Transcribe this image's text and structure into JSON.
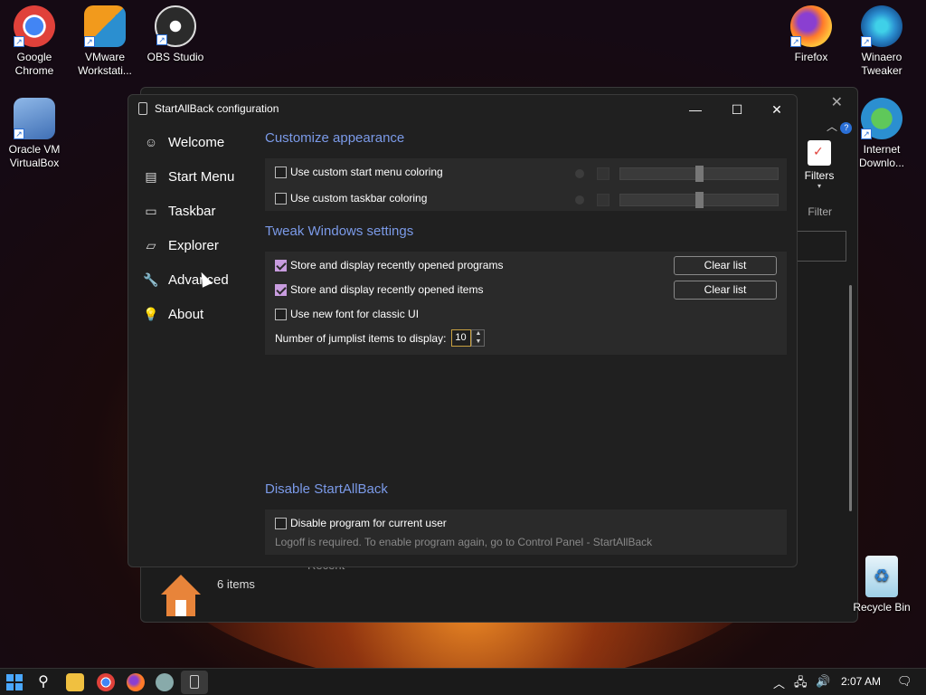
{
  "desktop": {
    "icons": [
      {
        "name": "desk-icon-chrome",
        "label": "Google Chrome",
        "color": "#e0413a"
      },
      {
        "name": "desk-icon-vmware",
        "label": "VMware Workstati...",
        "color": "#f29a1c"
      },
      {
        "name": "desk-icon-obs",
        "label": "OBS Studio",
        "color": "#2b2b2b"
      },
      {
        "name": "desk-icon-virtualbox",
        "label": "Oracle VM VirtualBox",
        "color": "#3f6fb5"
      },
      {
        "name": "desk-icon-firefox",
        "label": "Firefox",
        "color": "#ff7a2a"
      },
      {
        "name": "desk-icon-winaero",
        "label": "Winaero Tweaker",
        "color": "#2b8fd0"
      },
      {
        "name": "desk-icon-internet-download",
        "label": "Internet Downlo...",
        "color": "#3fa84a"
      },
      {
        "name": "desk-icon-recycle-bin",
        "label": "Recycle Bin",
        "color": "#9fd0e8"
      }
    ]
  },
  "explorer": {
    "filters_label": "Filters",
    "filter_group_label": "Filter",
    "items_count": "6 items",
    "recent_label": "Recent"
  },
  "window": {
    "title": "StartAllBack configuration"
  },
  "nav": [
    {
      "label": "Welcome",
      "icon": "smile-icon"
    },
    {
      "label": "Start Menu",
      "icon": "start-menu-icon"
    },
    {
      "label": "Taskbar",
      "icon": "taskbar-icon"
    },
    {
      "label": "Explorer",
      "icon": "folder-icon"
    },
    {
      "label": "Advanced",
      "icon": "wrench-icon"
    },
    {
      "label": "About",
      "icon": "lightbulb-icon"
    }
  ],
  "appearance": {
    "title": "Customize appearance",
    "start_menu_coloring": "Use custom start menu coloring",
    "taskbar_coloring": "Use custom taskbar coloring"
  },
  "tweaks": {
    "title": "Tweak Windows settings",
    "recent_programs": "Store and display recently opened programs",
    "recent_items": "Store and display recently opened items",
    "new_font": "Use new font for classic UI",
    "clear_list_1": "Clear list",
    "clear_list_2": "Clear list",
    "jumplist_label": "Number of jumplist items to display:",
    "jumplist_value": "10"
  },
  "disable": {
    "title": "Disable StartAllBack",
    "checkbox": "Disable program for current user",
    "hint": "Logoff is required. To enable program again, go to Control Panel - StartAllBack"
  },
  "taskbar": {
    "time": "2:07 AM"
  },
  "colors": {
    "accent": "#7b9ae8",
    "checkbox_checked": "#c89cdf"
  }
}
